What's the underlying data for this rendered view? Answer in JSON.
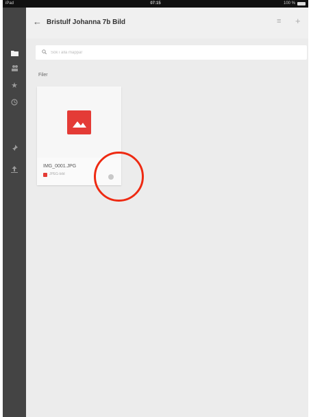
{
  "status_bar": {
    "carrier": "iPad",
    "time": "07:15",
    "battery": "100 %"
  },
  "header": {
    "title": "Bristulf Johanna 7b Bild"
  },
  "search": {
    "placeholder": "Sök i alla mappar",
    "value": ""
  },
  "section": {
    "label": "Filer"
  },
  "files": [
    {
      "name": "IMG_0001.JPG",
      "type": "JPEG-bild"
    }
  ],
  "icons": {
    "sidebar": [
      "folder-icon",
      "shared-icon",
      "star-icon",
      "recent-icon",
      "pin-icon",
      "upload-icon"
    ],
    "header": [
      "back-arrow-icon",
      "list-view-icon",
      "add-icon"
    ]
  },
  "colors": {
    "accent": "#e43b36",
    "sidebar_bg": "#444444",
    "annotation": "#ee2a12"
  }
}
